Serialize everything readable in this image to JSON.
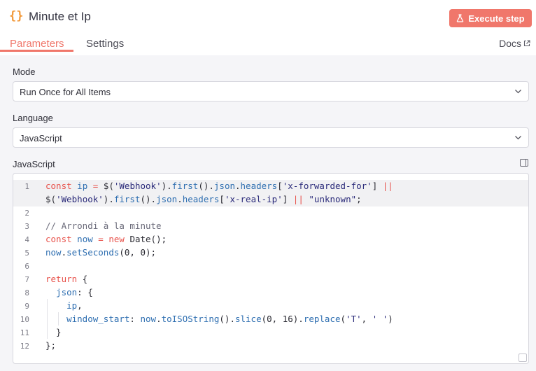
{
  "header": {
    "title": "Minute et Ip",
    "execute_label": "Execute step"
  },
  "tabs": {
    "parameters": "Parameters",
    "settings": "Settings",
    "docs": "Docs"
  },
  "fields": {
    "mode_label": "Mode",
    "mode_value": "Run Once for All Items",
    "language_label": "Language",
    "language_value": "JavaScript",
    "code_label": "JavaScript"
  },
  "code": {
    "line_numbers": [
      "1",
      "2",
      "3",
      "4",
      "5",
      "6",
      "7",
      "8",
      "9",
      "10",
      "11",
      "12"
    ],
    "lines": [
      "const ip = $('Webhook').first().json.headers['x-forwarded-for'] ||",
      "$('Webhook').first().json.headers['x-real-ip'] || \"unknown\";",
      "",
      "// Arrondi à la minute",
      "const now = new Date();",
      "now.setSeconds(0, 0);",
      "",
      "return {",
      "  json: {",
      "    ip,",
      "    window_start: now.toISOString().slice(0, 16).replace('T', ' ')",
      "  }",
      "};"
    ]
  },
  "colors": {
    "accent": "#f0776b",
    "node_icon": "#f29a3c",
    "panel_bg": "#f5f5f8"
  },
  "icons": {
    "node": "curly-braces-icon",
    "execute": "flask-icon",
    "docs": "external-link-icon",
    "select": "chevron-down-icon",
    "panel": "side-panel-icon"
  }
}
